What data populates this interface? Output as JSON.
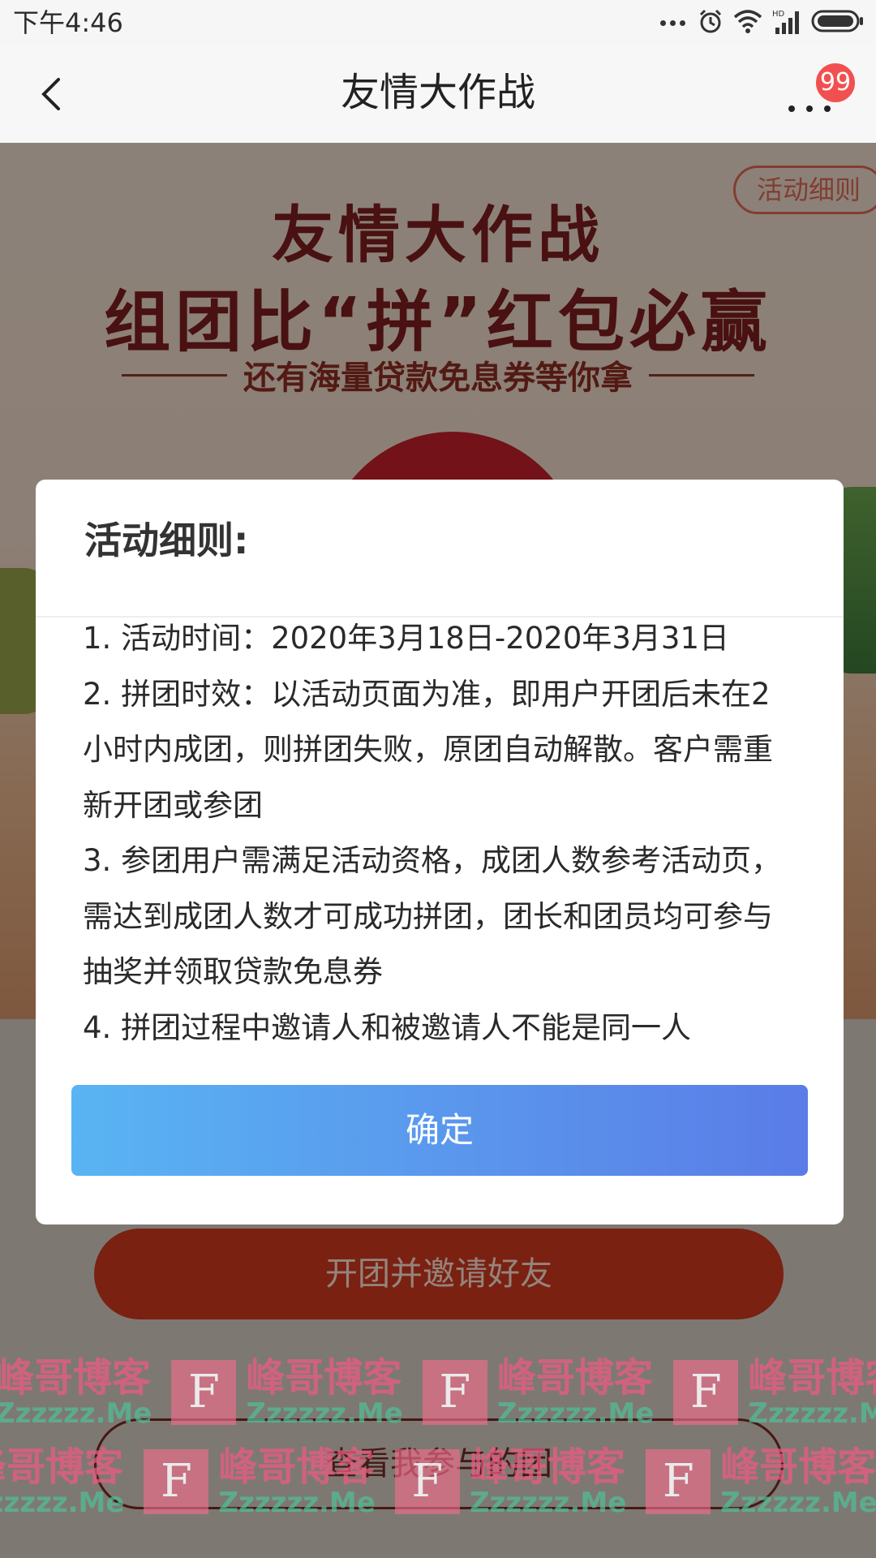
{
  "status_bar": {
    "time": "下午4:46",
    "icons": [
      "more-dots-icon",
      "alarm-icon",
      "wifi-icon",
      "hd-signal-icon",
      "battery-icon"
    ],
    "network_label": "HD"
  },
  "title_bar": {
    "title": "友情大作战",
    "badge_count": "99",
    "back_icon": "chevron-left-icon",
    "more_icon": "more-horizontal-icon"
  },
  "page": {
    "rules_link": "活动细则",
    "hero_title_1": "友情大作战",
    "hero_title_2": "组团比“拼”红包必赢",
    "hero_subtitle": "还有海量贷款免息券等你拿",
    "start_button": "开团并邀请好友",
    "my_team_button": "查看我参与的团"
  },
  "watermark": {
    "cn": "峰哥博客",
    "en": "Zzzzzz.Me",
    "letter": "F"
  },
  "modal": {
    "title": "活动细则:",
    "rules": [
      "1. 活动时间：2020年3月18日-2020年3月31日",
      "2. 拼团时效：以活动页面为准，即用户开团后未在2小时内成团，则拼团失败，原团自动解散。客户需重新开团或参团",
      "3. 参团用户需满足活动资格，成团人数参考活动页，需达到成团人数才可成功拼团，团长和团员均可参与抽奖并领取贷款免息券",
      "4. 拼团过程中邀请人和被邀请人不能是同一人"
    ],
    "confirm_label": "确定"
  },
  "colors": {
    "confirm_gradient_start": "#59b4f3",
    "confirm_gradient_end": "#5a7ce7",
    "badge": "#f25050",
    "hero_title": "#7e1e1e",
    "start_button": "#d33a1f"
  }
}
